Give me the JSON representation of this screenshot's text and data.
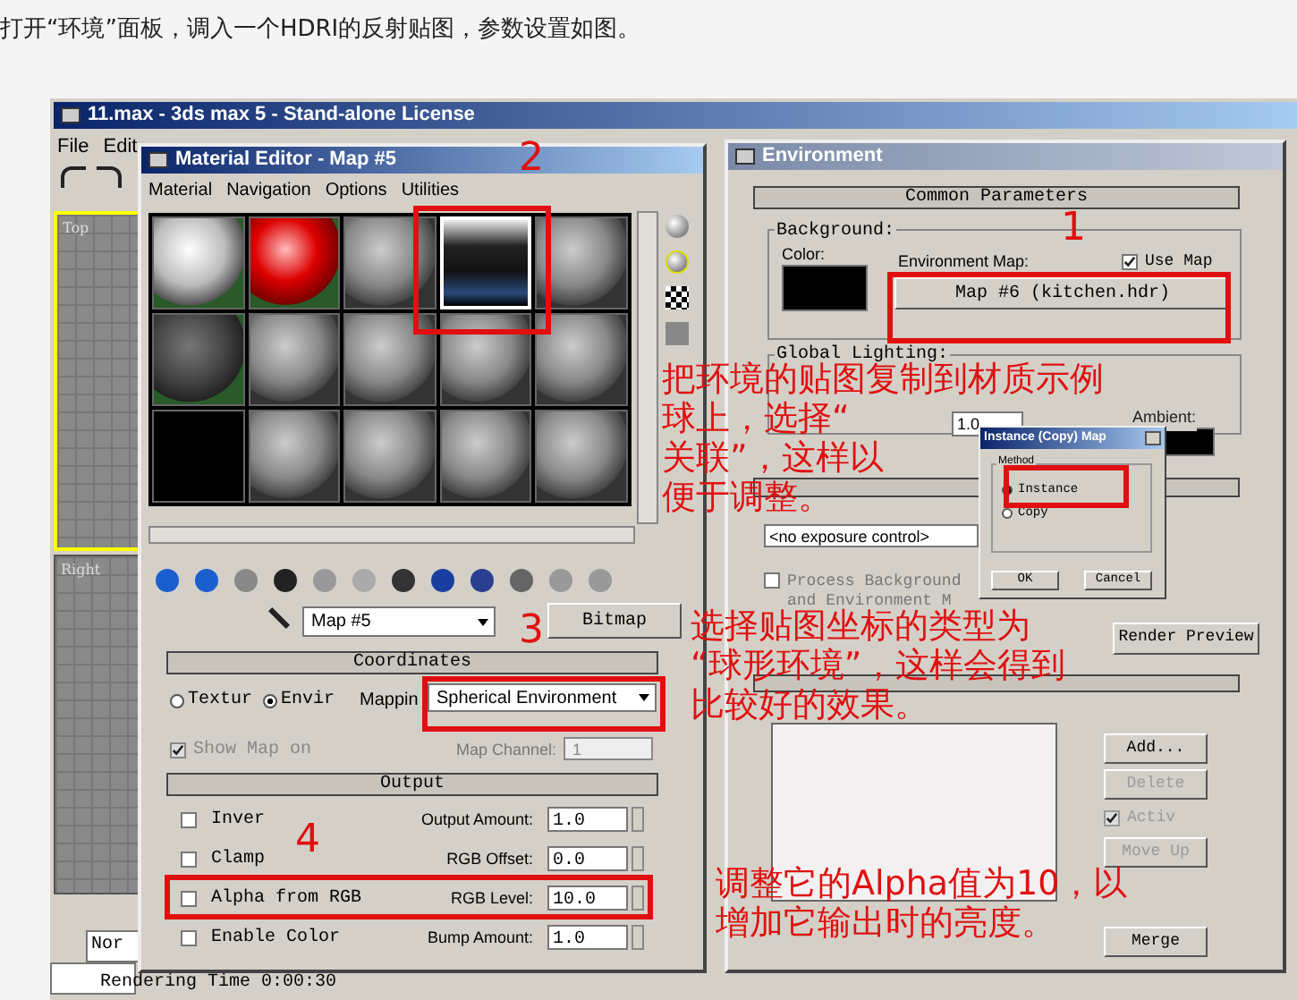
{
  "caption": "打开“环境”面板，调入一个HDRI的反射贴图，参数设置如图。",
  "app": {
    "title": "11.max - 3ds max 5 - Stand-alone License",
    "menu": [
      "File",
      "Edit"
    ],
    "viewports": [
      {
        "label": "Top"
      },
      {
        "label": "Right"
      }
    ],
    "status": {
      "field": "Nor",
      "render_time": "Rendering Time  0:00:30"
    }
  },
  "material_editor": {
    "title": "Material Editor - Map #5",
    "menu": [
      "Material",
      "Navigation",
      "Options",
      "Utilities"
    ],
    "slots": [
      {
        "kind": "white",
        "selected": false
      },
      {
        "kind": "red",
        "selected": false
      },
      {
        "kind": "grey",
        "selected": false
      },
      {
        "kind": "hdr",
        "selected": true
      },
      {
        "kind": "grey",
        "selected": false
      },
      {
        "kind": "dark",
        "selected": false
      },
      {
        "kind": "grey",
        "selected": false
      },
      {
        "kind": "grey",
        "selected": false
      },
      {
        "kind": "grey",
        "selected": false
      },
      {
        "kind": "grey",
        "selected": false
      },
      {
        "kind": "empty",
        "selected": false
      },
      {
        "kind": "grey",
        "selected": false
      },
      {
        "kind": "grey",
        "selected": false
      },
      {
        "kind": "grey",
        "selected": false
      },
      {
        "kind": "grey",
        "selected": false
      }
    ],
    "map_name": "Map #5",
    "map_type": "Bitmap",
    "coordinates": {
      "title": "Coordinates",
      "mapping_modes": [
        {
          "label": "Textur",
          "selected": false
        },
        {
          "label": "Envir",
          "selected": true
        }
      ],
      "mapping_label": "Mappin",
      "mapping": "Spherical Environment",
      "show_map": {
        "label": "Show Map on",
        "checked": true
      },
      "map_channel_label": "Map Channel:",
      "map_channel": "1"
    },
    "output": {
      "title": "Output",
      "rows": [
        {
          "label": "Inver",
          "checked": false,
          "param": "Output Amount:",
          "value": "1.0"
        },
        {
          "label": "Clamp",
          "checked": false,
          "param": "RGB Offset:",
          "value": "0.0"
        },
        {
          "label": "Alpha from RGB",
          "checked": false,
          "param": "RGB Level:",
          "value": "10.0"
        },
        {
          "label": "Enable Color",
          "checked": false,
          "param": "Bump Amount:",
          "value": "1.0"
        }
      ]
    }
  },
  "environment": {
    "title": "Environment",
    "common_title": "Common Parameters",
    "background_label": "Background:",
    "color_label": "Color:",
    "env_map_label": "Environment Map:",
    "use_map": {
      "label": "Use Map",
      "checked": true
    },
    "env_map_button": "Map #6 (kitchen.hdr)",
    "global_lighting_label": "Global Lighting:",
    "ambient_label": "Ambient:",
    "level": "1.0",
    "exposure_control": "<no exposure control>",
    "process_label": "Process Background and Environment M",
    "process_checked": false,
    "render_preview": "Render Preview",
    "buttons": [
      {
        "label": "Add...",
        "disabled": false
      },
      {
        "label": "Delete",
        "disabled": true
      }
    ],
    "active": {
      "label": "Activ",
      "checked": true
    },
    "buttons2": [
      {
        "label": "Move Up",
        "disabled": true
      },
      {
        "label": "Merge",
        "disabled": false
      }
    ]
  },
  "instance_dialog": {
    "title": "Instance (Copy) Map",
    "group": "Method",
    "options": [
      {
        "label": "Instance",
        "selected": true
      },
      {
        "label": "Copy",
        "selected": false
      }
    ],
    "buttons": [
      "OK",
      "Cancel"
    ]
  },
  "annotations": [
    {
      "number": "1",
      "lines": [
        "把环境的贴图复制到材质示例",
        "球上，选择“",
        "关联”，这样以",
        "便于调整。"
      ]
    },
    {
      "number": "2"
    },
    {
      "number": "3",
      "lines": [
        "选择贴图坐标的类型为",
        "“球形环境”，这样会得到",
        "比较好的效果。"
      ]
    },
    {
      "number": "4",
      "lines": [
        "调整它的Alpha值为10，以",
        "增加它输出时的亮度。"
      ]
    }
  ]
}
